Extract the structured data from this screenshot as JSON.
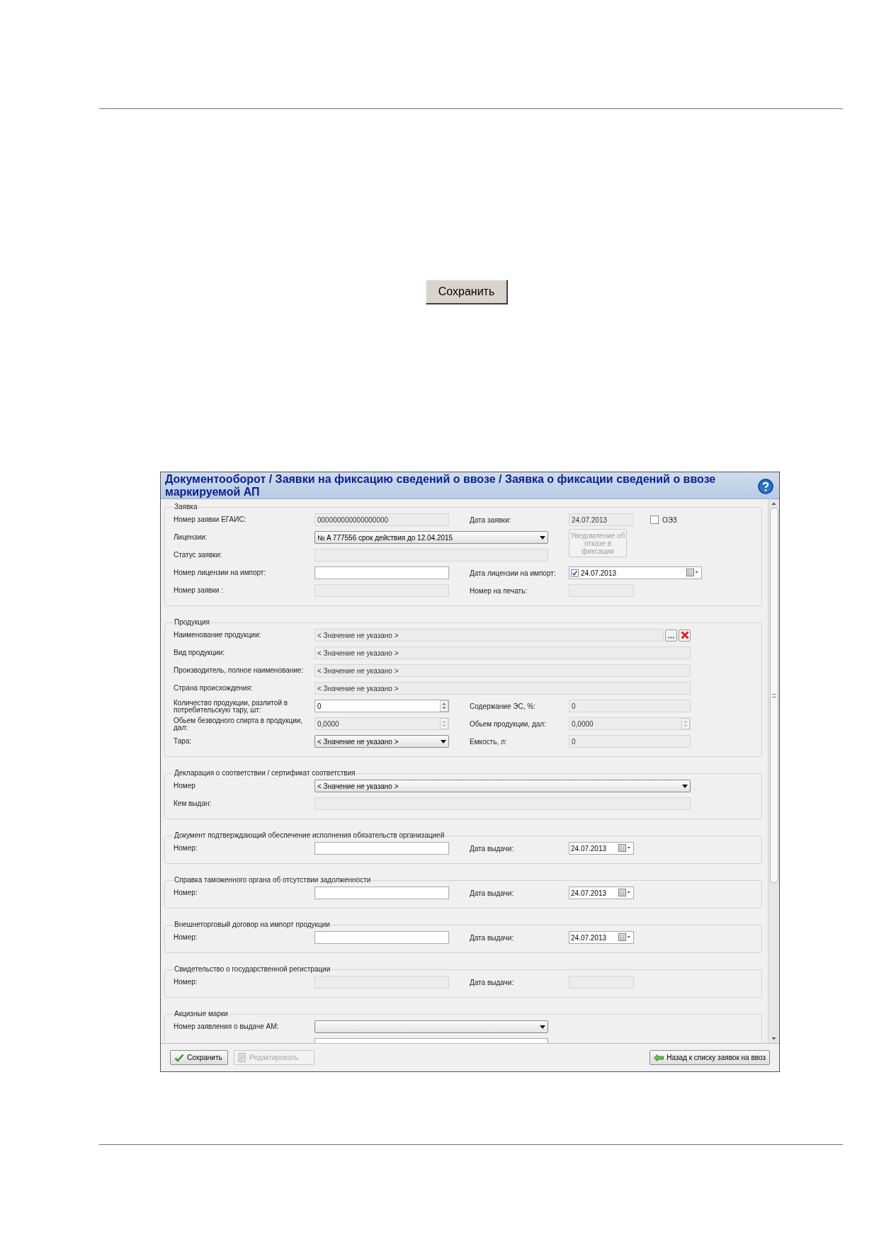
{
  "page": {
    "save_button": "Сохранить"
  },
  "window": {
    "title": "Документооборот / Заявки на фиксацию сведений о ввозе / Заявка о фиксации сведений о ввозе маркируемой АП"
  },
  "sections": [
    {
      "legend": "Заявка",
      "rows": [
        {
          "label": "Номер заявки ЕГАИС:",
          "control": {
            "kind": "input",
            "value": "000000000000000000",
            "disabled": true
          },
          "label2": "Дата заявки:",
          "control2": {
            "kind": "input",
            "value": "24.07.2013",
            "disabled": true
          },
          "extra": {
            "kind": "checkbox",
            "label": "ОЭЗ",
            "checked": false
          }
        },
        {
          "label": "Лицензии:",
          "control": {
            "kind": "select",
            "value": "№ A 777556 срок действия до 12.04.2015",
            "disabled": false
          },
          "extra": {
            "kind": "button",
            "label": "Уведомление об отказе в фиксации",
            "disabled": true
          }
        },
        {
          "label": "Статус заявки:",
          "control": {
            "kind": "input",
            "disabled": true
          }
        },
        {
          "label": "Номер лицензии на импорт:",
          "control": {
            "kind": "input",
            "disabled": false
          },
          "label2": "Дата лицензии на импорт:",
          "control2": {
            "kind": "date",
            "value": "24.07.2013",
            "checked": true,
            "disabled": false
          }
        },
        {
          "label": "Номер заявки :",
          "control": {
            "kind": "input",
            "disabled": true
          },
          "label2": "Номер на печать:",
          "control2": {
            "kind": "input",
            "disabled": true
          }
        }
      ]
    },
    {
      "legend": "Продукция",
      "rows": [
        {
          "label": "Наименование продукции:",
          "control": {
            "kind": "lookup",
            "value": "< Значение не указано >",
            "disabled": true
          }
        },
        {
          "label": "Вид продукции:",
          "control": {
            "kind": "input",
            "value": "< Значение не указано >",
            "disabled": true
          }
        },
        {
          "label": "Производитель, полное наименование:",
          "control": {
            "kind": "input",
            "value": "< Значение не указано >",
            "disabled": true
          }
        },
        {
          "label": "Страна происхождения:",
          "control": {
            "kind": "input",
            "value": "< Значение не указано >",
            "disabled": true
          }
        },
        {
          "label": "Количество продукции, разлитой в потребительскую тару, шт:",
          "control": {
            "kind": "spin",
            "value": "0",
            "disabled": false
          },
          "label2": "Содержание ЭС, %:",
          "control2": {
            "kind": "input",
            "value": "0",
            "disabled": true
          }
        },
        {
          "label": "Обьем безводного спирта в продукции, дал:",
          "control": {
            "kind": "spin",
            "value": "0,0000",
            "disabled": true
          },
          "label2": "Обьем продукции, дал:",
          "control2": {
            "kind": "spin",
            "value": "0,0000",
            "disabled": true
          }
        },
        {
          "label": "Тара:",
          "control": {
            "kind": "select",
            "value": "< Значение не указано >",
            "disabled": false
          },
          "label2": "Емкость, л:",
          "control2": {
            "kind": "input",
            "value": "0",
            "disabled": true
          }
        }
      ]
    },
    {
      "legend": "Декларация о соответствии / сертификат соответствия",
      "rows": [
        {
          "label": "Номер",
          "control": {
            "kind": "select",
            "value": "< Значение не указано >",
            "disabled": false
          }
        },
        {
          "label": "Кем выдан:",
          "control": {
            "kind": "input",
            "disabled": true
          }
        }
      ]
    },
    {
      "legend": "Документ подтверждающий обеспечение исполнения обязательств организацией",
      "rows": [
        {
          "label": "Номер:",
          "control": {
            "kind": "input",
            "disabled": false
          },
          "label2": "Дата выдачи:",
          "control2": {
            "kind": "date",
            "value": "24.07.2013",
            "disabled": false
          }
        }
      ]
    },
    {
      "legend": "Справка таможенного органа об отсутствии задолженности",
      "rows": [
        {
          "label": "Номер:",
          "control": {
            "kind": "input",
            "disabled": false
          },
          "label2": "Дата выдачи:",
          "control2": {
            "kind": "date",
            "value": "24.07.2013",
            "disabled": false
          }
        }
      ]
    },
    {
      "legend": "Внешнеторговый договор на импорт продукции",
      "rows": [
        {
          "label": "Номер:",
          "control": {
            "kind": "input",
            "disabled": false
          },
          "label2": "Дата выдачи:",
          "control2": {
            "kind": "date",
            "value": "24.07.2013",
            "disabled": false
          }
        }
      ]
    },
    {
      "legend": "Свидетельство о государственной регистрации",
      "rows": [
        {
          "label": "Номер:",
          "control": {
            "kind": "input",
            "disabled": true
          },
          "label2": "Дата выдачи:",
          "control2": {
            "kind": "input",
            "disabled": true
          }
        }
      ]
    },
    {
      "legend": "Акцизные марки",
      "rows": [
        {
          "label": "Номер заявления о выдаче АМ:",
          "control": {
            "kind": "select",
            "disabled": false
          }
        },
        {
          "control": {
            "kind": "input",
            "disabled": false
          }
        }
      ]
    }
  ],
  "toolbar": [
    {
      "kind": "save",
      "label": "Сохранить",
      "disabled": false
    },
    {
      "kind": "edit",
      "label": "Редактировать",
      "disabled": true
    },
    {
      "kind": "back",
      "label": "Назад к списку заявок на ввоз",
      "disabled": false
    }
  ]
}
